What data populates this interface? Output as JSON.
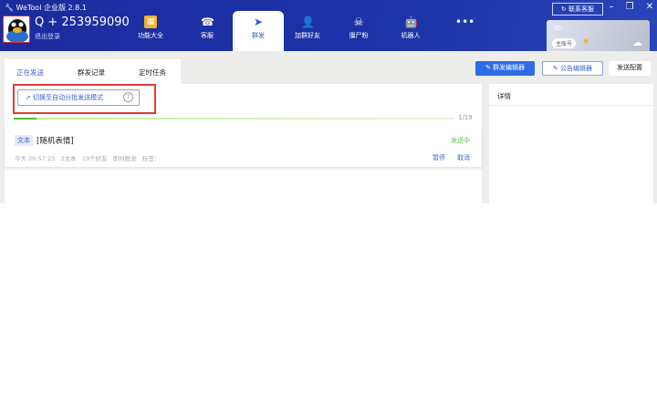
{
  "app": {
    "title": "WeTool 企业版 2.8.1",
    "account": "Q + 253959090",
    "logout": "退出登录",
    "contact": "联系客服",
    "id_label": "ID:",
    "account_badge": "主账号"
  },
  "nav": [
    {
      "label": "功能大全",
      "icon": "grid-icon"
    },
    {
      "label": "客服",
      "icon": "headset-icon"
    },
    {
      "label": "群发",
      "icon": "send-icon"
    },
    {
      "label": "加群好友",
      "icon": "add-user-icon"
    },
    {
      "label": "僵尸粉",
      "icon": "skull-icon"
    },
    {
      "label": "机器人",
      "icon": "robot-icon"
    },
    {
      "label": "",
      "icon": "more-icon"
    }
  ],
  "tabs": [
    "正在发送",
    "群发记录",
    "定时任务"
  ],
  "toolbar": {
    "mass_editor": "群发编辑器",
    "notice_editor": "公告编辑器",
    "send_config": "发送配置"
  },
  "switch_mode": "切换至自动分批发送模式",
  "progress": {
    "text": "1/19",
    "fraction": 0.0526
  },
  "task": {
    "type": "文本",
    "content": "[随机表情]",
    "status": "发送中",
    "time": "今天 20:57:23",
    "count": "2文本",
    "friends": "19个好友",
    "mode": "即时群发",
    "tags": "标签：",
    "pause": "暂停",
    "cancel": "取消"
  },
  "detail": {
    "title": "详情"
  },
  "colors": {
    "header": "#1b2b9e",
    "accent": "#2e6be6",
    "success": "#5cc94a"
  }
}
